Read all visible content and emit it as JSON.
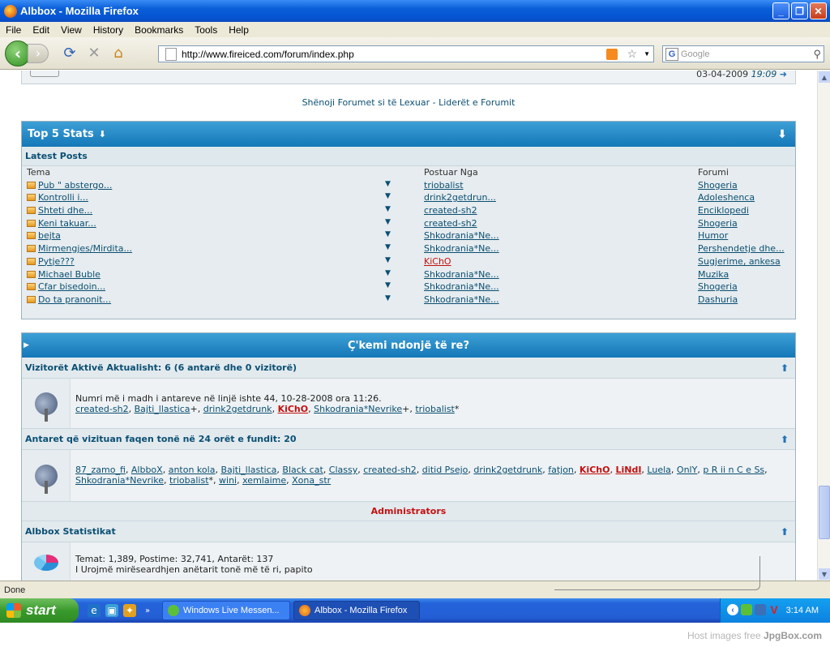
{
  "window": {
    "title": "Albbox - Mozilla Firefox"
  },
  "menu": [
    "File",
    "Edit",
    "View",
    "History",
    "Bookmarks",
    "Tools",
    "Help"
  ],
  "nav": {
    "url": "http://www.fireiced.com/forum/index.php",
    "search_placeholder": "Google"
  },
  "top_remnant": {
    "date": "03-04-2009",
    "time": "19:09"
  },
  "forum_links": "Shënoji Forumet si të Lexuar - Liderët e Forumit",
  "top5": {
    "title": "Top 5 Stats",
    "latest_label": "Latest Posts",
    "headers": {
      "tema": "Tema",
      "postuar": "Postuar Nga",
      "forumi": "Forumi"
    },
    "rows": [
      {
        "tema": "Pub \" abstergo...",
        "by": "triobalist",
        "forum": "Shogeria",
        "red": false
      },
      {
        "tema": "Kontrolli i...",
        "by": "drink2getdrun...",
        "forum": "Adoleshenca",
        "red": false
      },
      {
        "tema": "Shteti dhe...",
        "by": "created-sh2",
        "forum": "Enciklopedi",
        "red": false
      },
      {
        "tema": "Keni takuar...",
        "by": "created-sh2",
        "forum": "Shogeria",
        "red": false
      },
      {
        "tema": "bejta",
        "by": "Shkodrania*Ne...",
        "forum": "Humor",
        "red": false
      },
      {
        "tema": "Mirmengjes/Mirdita...",
        "by": "Shkodrania*Ne...",
        "forum": "Pershendetje dhe...",
        "red": false
      },
      {
        "tema": "Pytje???",
        "by": "KiChO",
        "forum": "Sugjerime, ankesa",
        "red": true
      },
      {
        "tema": "Michael Buble",
        "by": "Shkodrania*Ne...",
        "forum": "Muzika",
        "red": false
      },
      {
        "tema": "Cfar bisedoin...",
        "by": "Shkodrania*Ne...",
        "forum": "Shogeria",
        "red": false
      },
      {
        "tema": "Do ta pranonit...",
        "by": "Shkodrania*Ne...",
        "forum": "Dashuria",
        "red": false
      }
    ]
  },
  "whatsnew": {
    "title": "Ç'kemi ndonjë të re?",
    "active_title": "Vizitorët Aktivë Aktualisht: 6 (6 antarë dhe 0 vizitorë)",
    "active_line": "Numri më i madh i antareve në linjë ishte 44, 10-28-2008 ora 11:26.",
    "active_users": [
      {
        "name": "created-sh2",
        "suffix": ", ",
        "red": false
      },
      {
        "name": "Bajti_llastica",
        "suffix": "+, ",
        "red": false
      },
      {
        "name": "drink2getdrunk",
        "suffix": ", ",
        "red": false
      },
      {
        "name": "KiChO",
        "suffix": ", ",
        "red": true
      },
      {
        "name": "Shkodrania*Nevrike",
        "suffix": "+, ",
        "red": false
      },
      {
        "name": "triobalist",
        "suffix": "*",
        "red": false
      }
    ],
    "day_title": "Antaret që vizituan faqen tonë në 24 orët e fundit: 20",
    "day_users": [
      {
        "name": "87_zamo_fi",
        "suffix": ", ",
        "red": false
      },
      {
        "name": "AlbboX",
        "suffix": ", ",
        "red": false
      },
      {
        "name": "anton kola",
        "suffix": ", ",
        "red": false
      },
      {
        "name": "Bajti_llastica",
        "suffix": ", ",
        "red": false
      },
      {
        "name": "Black cat",
        "suffix": ", ",
        "red": false
      },
      {
        "name": "Classy",
        "suffix": ", ",
        "red": false
      },
      {
        "name": "created-sh2",
        "suffix": ", ",
        "red": false
      },
      {
        "name": "ditid Psejo",
        "suffix": ", ",
        "red": false
      },
      {
        "name": "drink2getdrunk",
        "suffix": ", ",
        "red": false
      },
      {
        "name": "fatjon",
        "suffix": ", ",
        "red": false
      },
      {
        "name": "KiChO",
        "suffix": ", ",
        "red": true
      },
      {
        "name": "LiNdI",
        "suffix": ", ",
        "red": true
      },
      {
        "name": "Luela",
        "suffix": ", ",
        "red": false
      },
      {
        "name": "OnlY",
        "suffix": ", ",
        "red": false
      },
      {
        "name": "p R ii n C e Ss",
        "suffix": ", ",
        "red": false
      },
      {
        "name": "Shkodrania*Nevrike",
        "suffix": ", ",
        "red": false
      },
      {
        "name": "triobalist",
        "suffix": "*, ",
        "red": false
      },
      {
        "name": "wini",
        "suffix": ", ",
        "red": false
      },
      {
        "name": "xemlaime",
        "suffix": ", ",
        "red": false
      },
      {
        "name": "Xona_str",
        "suffix": "",
        "red": false
      }
    ],
    "admins": "Administrators",
    "stats_title": "Albbox Statistikat",
    "stats_line": "Temat: 1,389, Postime: 32,741, Antarët: 137",
    "welcome": "I Urojmë mirëseardhjen anëtarit tonë më të ri, papito"
  },
  "status": "Done",
  "taskbar": {
    "start": "start",
    "task1": "Windows Live Messen...",
    "task2": "Albbox - Mozilla Firefox",
    "clock": "3:14 AM"
  },
  "watermark": {
    "prefix": "Host images free",
    "brand": "JpgBox.com"
  },
  "colors": {
    "header_blue": "#1a86c9",
    "link": "#0b4f73",
    "red_user": "#c41010"
  }
}
